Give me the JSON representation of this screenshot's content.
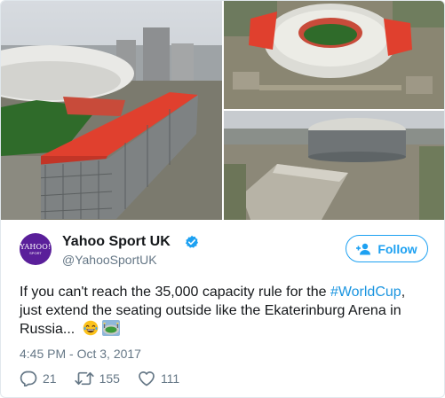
{
  "tweet": {
    "author_name": "Yahoo Sport UK",
    "handle": "@YahooSportUK",
    "avatar_logo": "YAHOO!",
    "avatar_sub": "SPORT",
    "follow_label": "Follow",
    "text_part1": "If you can't reach the 35,000 capacity rule for the ",
    "hashtag": "#WorldCup",
    "text_part2": ", just extend the seating outside like the Ekaterinburg Arena in Russia...",
    "emoji_1": "face-with-tears-of-joy",
    "emoji_2": "stadium",
    "timestamp": "4:45 PM - Oct 3, 2017",
    "replies": "21",
    "retweets": "155",
    "likes": "111"
  },
  "colors": {
    "brand_blue": "#1da1f2",
    "avatar_purple": "#5a1f9a",
    "seat_red": "#e0402e",
    "pitch_green": "#2f6b2a"
  },
  "icons": {
    "verified": "verified-badge-icon",
    "follow": "add-user-icon",
    "reply": "reply-icon",
    "retweet": "retweet-icon",
    "like": "heart-icon"
  }
}
